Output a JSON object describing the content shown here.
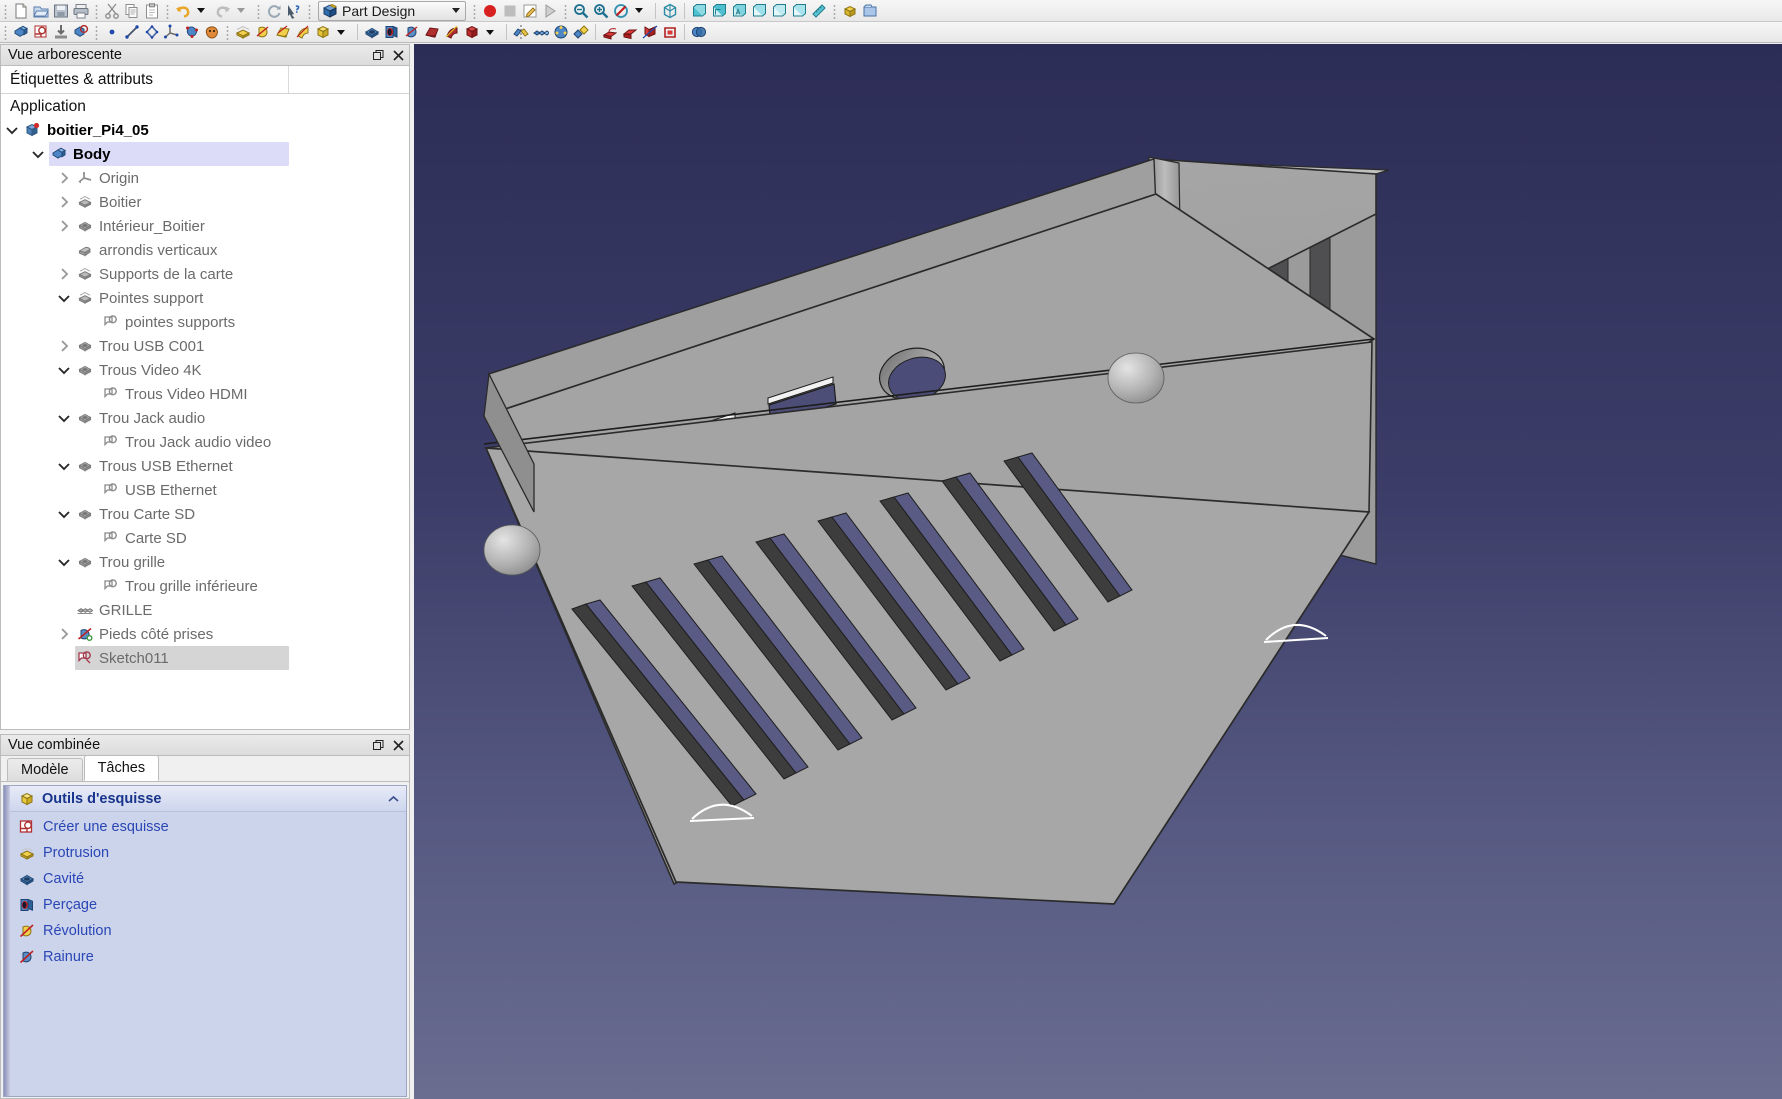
{
  "window": {
    "workbench": "Part Design"
  },
  "toolbar_top": {
    "groups": [
      {
        "buttons": [
          {
            "name": "new-document-icon",
            "tip": "Nouveau"
          },
          {
            "name": "open-document-icon",
            "tip": "Ouvrir"
          },
          {
            "name": "save-document-icon",
            "tip": "Enregistrer"
          },
          {
            "name": "print-document-icon",
            "tip": "Imprimer"
          }
        ]
      },
      {
        "buttons": [
          {
            "name": "cut-icon",
            "tip": "Couper"
          },
          {
            "name": "copy-icon",
            "tip": "Copier"
          },
          {
            "name": "paste-icon",
            "tip": "Coller"
          }
        ]
      },
      {
        "buttons": [
          {
            "name": "undo-icon",
            "tip": "Annuler"
          },
          {
            "name": "undo-dropdown-icon",
            "tip": "Historique annuler"
          },
          {
            "name": "redo-icon",
            "tip": "Rétablir"
          },
          {
            "name": "redo-dropdown-icon",
            "tip": "Historique rétablir"
          }
        ]
      },
      {
        "buttons": [
          {
            "name": "refresh-icon",
            "tip": "Rafraîchir"
          },
          {
            "name": "whats-this-icon",
            "tip": "Qu'est-ce que c'est ?"
          }
        ]
      },
      {
        "buttons": [
          {
            "name": "macro-record-icon",
            "tip": "Enregistrer une macro"
          },
          {
            "name": "macro-stop-icon",
            "tip": "Arrêter l'enregistrement"
          },
          {
            "name": "macro-edit-icon",
            "tip": "Macros"
          },
          {
            "name": "macro-execute-icon",
            "tip": "Exécuter la macro"
          }
        ]
      },
      {
        "buttons": [
          {
            "name": "fit-all-icon",
            "tip": "Tout afficher"
          },
          {
            "name": "fit-selection-icon",
            "tip": "Ajuster la sélection"
          },
          {
            "name": "draw-style-icon",
            "tip": "Style de dessin"
          },
          {
            "name": "draw-style-dropdown-icon",
            "tip": "Styles"
          }
        ]
      },
      {
        "buttons": [
          {
            "name": "axonometric-view-icon",
            "tip": "Vue axonométrique"
          },
          {
            "name": "front-view-icon",
            "tip": "Vue de face"
          },
          {
            "name": "top-view-icon",
            "tip": "Vue de dessus"
          },
          {
            "name": "right-view-icon",
            "tip": "Vue de droite"
          },
          {
            "name": "rear-view-icon",
            "tip": "Vue arrière"
          },
          {
            "name": "bottom-view-icon",
            "tip": "Vue de dessous"
          },
          {
            "name": "left-view-icon",
            "tip": "Vue de gauche"
          },
          {
            "name": "measure-icon",
            "tip": "Mesurer"
          }
        ]
      },
      {
        "buttons": [
          {
            "name": "create-part-icon",
            "tip": "Créer un corps"
          },
          {
            "name": "create-group-icon",
            "tip": "Créer un groupe"
          }
        ]
      }
    ]
  },
  "toolbar_second": {
    "groups": [
      {
        "buttons": [
          {
            "name": "create-body-icon",
            "tip": "Créer un corps"
          },
          {
            "name": "create-sketch-icon",
            "tip": "Créer une esquisse"
          },
          {
            "name": "attach-sketch-icon",
            "tip": "Attacher une esquisse"
          },
          {
            "name": "validate-sketch-icon",
            "tip": "Valider l'esquisse"
          }
        ]
      },
      {
        "buttons": [
          {
            "name": "point-datum-icon",
            "tip": "Créer un point"
          },
          {
            "name": "line-datum-icon",
            "tip": "Créer une ligne"
          },
          {
            "name": "plane-datum-icon",
            "tip": "Créer un plan"
          },
          {
            "name": "local-coordinate-system-icon",
            "tip": "Créer un système de coordonnées"
          },
          {
            "name": "shapebinder-icon",
            "tip": "Créer une forme liée"
          },
          {
            "name": "clone-icon",
            "tip": "Créer un clone"
          }
        ]
      },
      {
        "buttons": [
          {
            "name": "pad-icon",
            "tip": "Protrusion"
          },
          {
            "name": "revolution-icon",
            "tip": "Révolution"
          },
          {
            "name": "additive-loft-icon",
            "tip": "Lissage additif"
          },
          {
            "name": "additive-pipe-icon",
            "tip": "Balayage additif"
          },
          {
            "name": "additive-primitive-icon",
            "tip": "Primitive additive"
          },
          {
            "name": "additive-dropdown-icon",
            "tip": "Plus"
          }
        ]
      },
      {
        "buttons": [
          {
            "name": "pocket-icon",
            "tip": "Cavité"
          },
          {
            "name": "hole-icon",
            "tip": "Perçage"
          },
          {
            "name": "groove-icon",
            "tip": "Rainure"
          },
          {
            "name": "subtractive-loft-icon",
            "tip": "Lissage soustractif"
          },
          {
            "name": "subtractive-pipe-icon",
            "tip": "Balayage soustractif"
          },
          {
            "name": "subtractive-primitive-icon",
            "tip": "Primitive soustractive"
          },
          {
            "name": "subtractive-dropdown-icon",
            "tip": "Plus"
          }
        ]
      },
      {
        "buttons": [
          {
            "name": "mirrored-icon",
            "tip": "Symétrie"
          },
          {
            "name": "linear-pattern-icon",
            "tip": "Répétition linéaire"
          },
          {
            "name": "polar-pattern-icon",
            "tip": "Répétition circulaire"
          },
          {
            "name": "multitransform-icon",
            "tip": "Créer une multitransformation"
          }
        ]
      },
      {
        "buttons": [
          {
            "name": "fillet-icon",
            "tip": "Congé"
          },
          {
            "name": "chamfer-icon",
            "tip": "Chanfrein"
          },
          {
            "name": "draft-icon",
            "tip": "Dépouille"
          },
          {
            "name": "thickness-icon",
            "tip": "Épaisseur"
          }
        ]
      },
      {
        "buttons": [
          {
            "name": "boolean-operation-icon",
            "tip": "Opération booléenne"
          }
        ]
      }
    ]
  },
  "tree_dock": {
    "title": "Vue arborescente",
    "restore_icon": "restore-icon",
    "close_icon": "close-icon",
    "columns": [
      "Étiquettes & attributs",
      ""
    ],
    "root_label": "Application",
    "items": [
      {
        "label": "boitier_Pi4_05",
        "depth": 0,
        "twist": "down",
        "icon": "document-icon",
        "bold": true,
        "selected": "none"
      },
      {
        "label": "Body",
        "depth": 1,
        "twist": "down",
        "icon": "body-icon",
        "bold": true,
        "selected": "blue"
      },
      {
        "label": "Origin",
        "depth": 2,
        "twist": "right",
        "icon": "origin-icon",
        "bold": false,
        "selected": "none"
      },
      {
        "label": "Boitier",
        "depth": 2,
        "twist": "right",
        "icon": "pad-feature-icon",
        "bold": false,
        "selected": "none"
      },
      {
        "label": "Intérieur_Boitier",
        "depth": 2,
        "twist": "right",
        "icon": "pocket-feature-icon",
        "bold": false,
        "selected": "none"
      },
      {
        "label": "arrondis verticaux",
        "depth": 2,
        "twist": "none",
        "icon": "fillet-feature-icon",
        "bold": false,
        "selected": "none"
      },
      {
        "label": "Supports de la carte",
        "depth": 2,
        "twist": "right",
        "icon": "pad-feature-icon",
        "bold": false,
        "selected": "none"
      },
      {
        "label": "Pointes support",
        "depth": 2,
        "twist": "down",
        "icon": "pad-feature-icon",
        "bold": false,
        "selected": "none"
      },
      {
        "label": "pointes supports",
        "depth": 3,
        "twist": "none",
        "icon": "sketch-icon",
        "bold": false,
        "selected": "none"
      },
      {
        "label": "Trou USB C001",
        "depth": 2,
        "twist": "right",
        "icon": "pocket-feature-icon",
        "bold": false,
        "selected": "none"
      },
      {
        "label": "Trous Video 4K",
        "depth": 2,
        "twist": "down",
        "icon": "pocket-feature-icon",
        "bold": false,
        "selected": "none"
      },
      {
        "label": "Trous Video HDMI",
        "depth": 3,
        "twist": "none",
        "icon": "sketch-icon",
        "bold": false,
        "selected": "none"
      },
      {
        "label": "Trou Jack audio",
        "depth": 2,
        "twist": "down",
        "icon": "pocket-feature-icon",
        "bold": false,
        "selected": "none"
      },
      {
        "label": "Trou Jack audio video",
        "depth": 3,
        "twist": "none",
        "icon": "sketch-icon",
        "bold": false,
        "selected": "none"
      },
      {
        "label": "Trous USB Ethernet",
        "depth": 2,
        "twist": "down",
        "icon": "pocket-feature-icon",
        "bold": false,
        "selected": "none"
      },
      {
        "label": "USB Ethernet",
        "depth": 3,
        "twist": "none",
        "icon": "sketch-icon",
        "bold": false,
        "selected": "none"
      },
      {
        "label": "Trou Carte SD",
        "depth": 2,
        "twist": "down",
        "icon": "pocket-feature-icon",
        "bold": false,
        "selected": "none"
      },
      {
        "label": "Carte SD",
        "depth": 3,
        "twist": "none",
        "icon": "sketch-icon",
        "bold": false,
        "selected": "none"
      },
      {
        "label": "Trou grille",
        "depth": 2,
        "twist": "down",
        "icon": "pocket-feature-icon",
        "bold": false,
        "selected": "none"
      },
      {
        "label": "Trou grille inférieure",
        "depth": 3,
        "twist": "none",
        "icon": "sketch-icon",
        "bold": false,
        "selected": "none"
      },
      {
        "label": "GRILLE",
        "depth": 2,
        "twist": "none",
        "icon": "linear-pattern-feature-icon",
        "bold": false,
        "selected": "none"
      },
      {
        "label": "Pieds côté prises",
        "depth": 2,
        "twist": "right",
        "icon": "groove-feature-icon",
        "bold": false,
        "selected": "none"
      },
      {
        "label": "Sketch011",
        "depth": 2,
        "twist": "none",
        "icon": "sketch-red-icon",
        "bold": false,
        "selected": "gray"
      }
    ]
  },
  "combined_dock": {
    "title": "Vue combinée",
    "restore_icon": "restore-icon",
    "close_icon": "close-icon",
    "tabs": [
      {
        "label": "Modèle",
        "active": false
      },
      {
        "label": "Tâches",
        "active": true
      }
    ],
    "task_group": {
      "title": "Outils d'esquisse",
      "icon": "yellow-box-icon",
      "collapse_icon": "chevron-up-icon",
      "items": [
        {
          "label": "Créer une esquisse",
          "icon": "create-sketch-icon"
        },
        {
          "label": "Protrusion",
          "icon": "pad-icon"
        },
        {
          "label": "Cavité",
          "icon": "pocket-icon"
        },
        {
          "label": "Perçage",
          "icon": "hole-icon"
        },
        {
          "label": "Révolution",
          "icon": "revolution-icon"
        },
        {
          "label": "Rainure",
          "icon": "groove-icon"
        }
      ]
    }
  },
  "viewport": {
    "name": "3d-viewport",
    "background_top": "#2c2d56",
    "background_bottom": "#6a6d90",
    "model_color": "#a3a3a3",
    "model_dark": "#4c4c4c",
    "hole_color": "#4a4b77",
    "document": "boitier_Pi4_05"
  }
}
